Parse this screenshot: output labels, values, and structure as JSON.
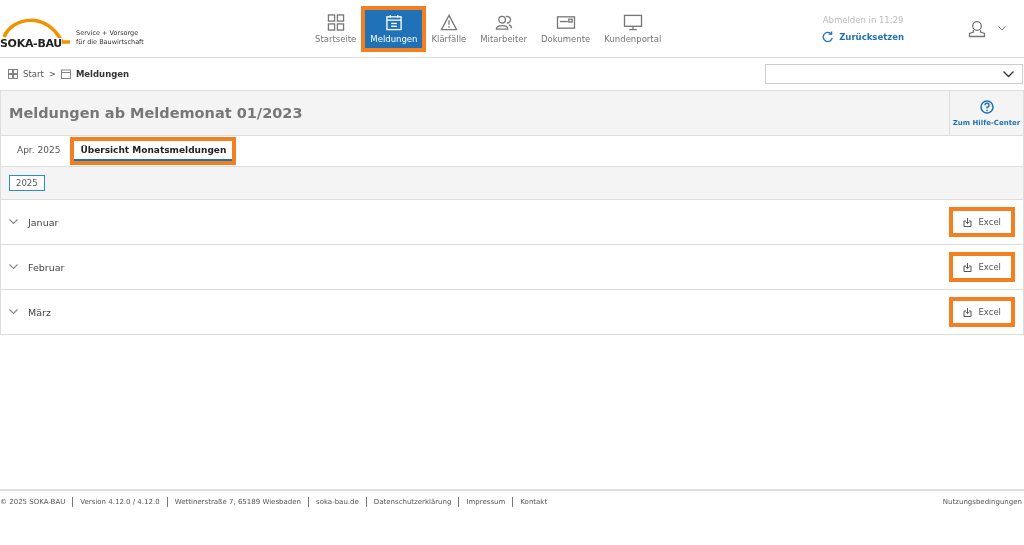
{
  "header": {
    "logo": "SOKA-BAU",
    "tagline_1": "Service + Vorsorge",
    "tagline_2": "für die Bauwirtschaft",
    "nav": [
      {
        "label": "Startseite",
        "selected": false,
        "highlighted": false
      },
      {
        "label": "Meldungen",
        "selected": true,
        "highlighted": true
      },
      {
        "label": "Klärfälle",
        "selected": false,
        "highlighted": false
      },
      {
        "label": "Mitarbeiter",
        "selected": false,
        "highlighted": false
      },
      {
        "label": "Dokumente",
        "selected": false,
        "highlighted": false
      },
      {
        "label": "Kundenportal",
        "selected": false,
        "highlighted": false
      }
    ],
    "logout_timer": "Abmelden in 11:29",
    "reset": "Zurücksetzen"
  },
  "breadcrumb": [
    "Start",
    ">",
    "Meldungen"
  ],
  "page_title": "Meldungen ab Meldemonat 01/2023",
  "help": "Zum Hilfe-Center",
  "tabs": [
    {
      "label": "Apr. 2025",
      "selected": false,
      "highlighted": false
    },
    {
      "label": "Übersicht Monatsmeldungen",
      "selected": true,
      "highlighted": true
    }
  ],
  "year_filter": [
    {
      "label": "2025",
      "selected": true
    }
  ],
  "months": [
    {
      "name": "Januar",
      "expanded": false,
      "action": "Excel",
      "highlighted": true
    },
    {
      "name": "Februar",
      "expanded": false,
      "action": "Excel",
      "highlighted": true
    },
    {
      "name": "März",
      "expanded": false,
      "action": "Excel",
      "highlighted": true
    }
  ],
  "footer": {
    "items": [
      "© 2025 SOKA-BAU",
      "Version 4.12.0 / 4.12.0",
      "Wettinerstraße 7, 65189 Wiesbaden",
      "soka-bau.de",
      "Datenschutzerklärung",
      "Impressum",
      "Kontakt"
    ],
    "right": "Nutzungsbedingungen"
  }
}
